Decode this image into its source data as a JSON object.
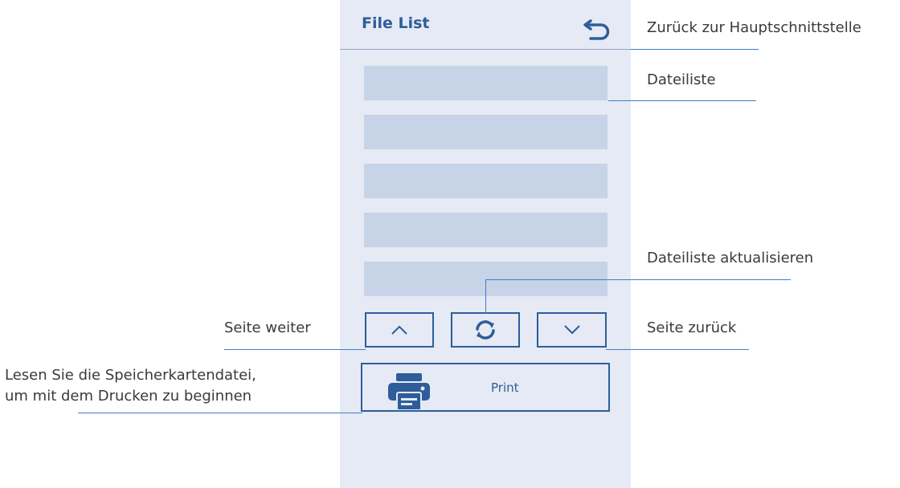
{
  "screen": {
    "title": "File List",
    "print_label": "Print",
    "file_slots": [
      "",
      "",
      "",
      "",
      ""
    ]
  },
  "annotations": {
    "back": "Zurück zur Hauptschnittstelle",
    "file_list": "Dateiliste",
    "refresh": "Dateiliste aktualisieren",
    "page_up": "Seite weiter",
    "page_down": "Seite zurück",
    "print_line1": "Lesen Sie die Speicherkartendatei,",
    "print_line2": "um mit dem Drucken zu beginnen"
  },
  "colors": {
    "accent": "#2e5d99",
    "panel": "#e5eaf4",
    "slot": "#c7d3e6",
    "leader": "#3f7ec4"
  }
}
